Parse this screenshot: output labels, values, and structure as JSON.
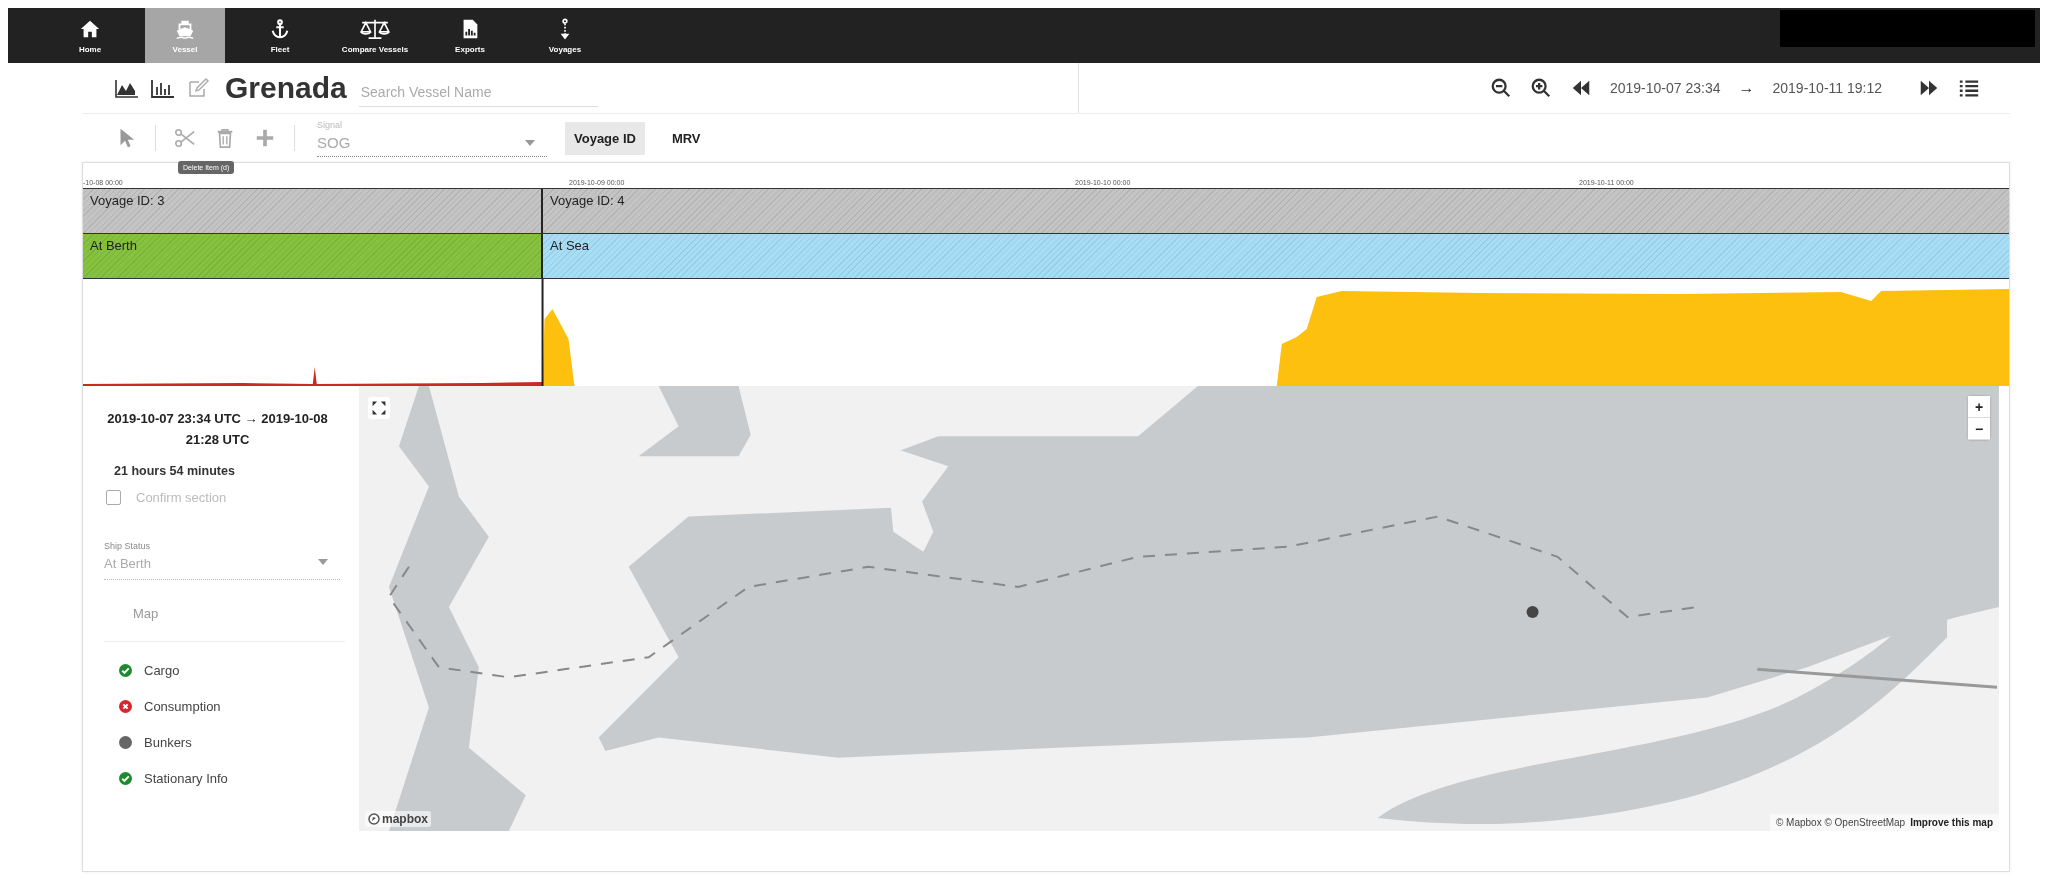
{
  "nav": {
    "items": [
      {
        "label": "Home",
        "selected": false
      },
      {
        "label": "Vessel",
        "selected": true
      },
      {
        "label": "Fleet",
        "selected": false
      },
      {
        "label": "Compare Vessels",
        "selected": false
      },
      {
        "label": "Exports",
        "selected": false
      },
      {
        "label": "Voyages",
        "selected": false
      }
    ]
  },
  "header": {
    "title": "Grenada",
    "search": {
      "placeholder": "Search Vessel Name"
    },
    "range_from": "2019-10-07 23:34",
    "range_arrow": "→",
    "range_to": "2019-10-11 19:12"
  },
  "toolbar": {
    "signal": {
      "label": "Signal",
      "value": "SOG"
    },
    "tooltip": "Delete Item (d)",
    "segments": [
      {
        "label": "Voyage ID",
        "selected": true
      },
      {
        "label": "MRV",
        "selected": false
      }
    ]
  },
  "timeline": {
    "ticks": [
      "-10-08 00:00",
      "2019-10-09 00:00",
      "2019-10-10 00:00",
      "2019-10-11 00:00"
    ],
    "voyages": [
      {
        "label": "Voyage ID: 3"
      },
      {
        "label": "Voyage ID: 4"
      }
    ],
    "statuses": [
      {
        "label": "At Berth",
        "kind": "berth"
      },
      {
        "label": "At Sea",
        "kind": "sea"
      }
    ]
  },
  "section": {
    "range": "2019-10-07 23:34 UTC  →  2019-10-08 21:28 UTC",
    "duration": "21 hours 54 minutes",
    "confirm": {
      "label": "Confirm section",
      "checked": false
    },
    "ship_status": {
      "label": "Ship Status",
      "value": "At Berth"
    },
    "map_label": "Map",
    "checklist": [
      {
        "label": "Cargo",
        "kind": "ok"
      },
      {
        "label": "Consumption",
        "kind": "error"
      },
      {
        "label": "Bunkers",
        "kind": "none"
      },
      {
        "label": "Stationary Info",
        "kind": "ok"
      }
    ]
  },
  "map": {
    "zoom_in": "+",
    "zoom_out": "−",
    "logo": "mapbox",
    "attribution": "© Mapbox © OpenStreetMap",
    "improve_link": "Improve this map"
  }
}
